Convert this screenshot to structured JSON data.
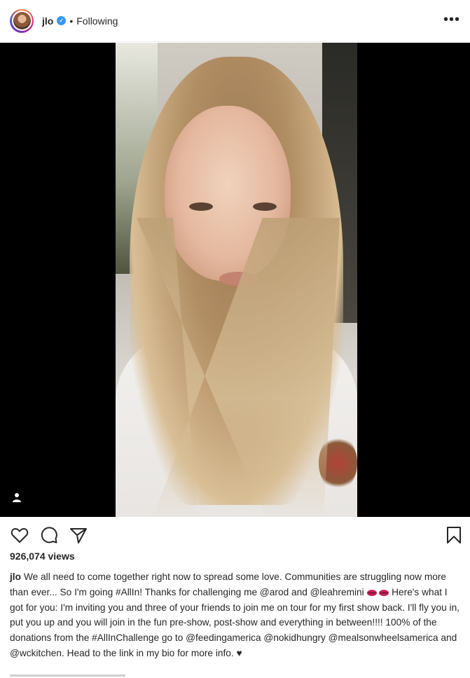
{
  "header": {
    "username": "jlo",
    "separator": "•",
    "follow_status": "Following",
    "more_label": "•••"
  },
  "media": {
    "type": "video"
  },
  "actions": {
    "icons": [
      "heart-icon",
      "comment-icon",
      "share-icon",
      "bookmark-icon"
    ]
  },
  "stats": {
    "views": "926,074 views"
  },
  "caption": {
    "username": "jlo",
    "text_part1": "We all need to come together right now to spread some love. Communities are struggling now more than ever... So I'm going #AllIn! Thanks for challenging me @arod and @leahremini",
    "text_part2": "Here's what I got for you: I'm inviting you and three of your friends to join me on tour for my first show back. I'll fly you in, put you up and you will join in the fun pre-show, post-show and everything in between!!!! 100% of the donations from the #AllInChallenge go to @feedingamerica @nokidhungry @mealsonwheelsamerica and @wckitchen. Head to the link in my bio for more info.",
    "heart": "♥"
  },
  "colors": {
    "verified": "#3897f0",
    "text": "#262626",
    "media_bg": "#000000"
  }
}
